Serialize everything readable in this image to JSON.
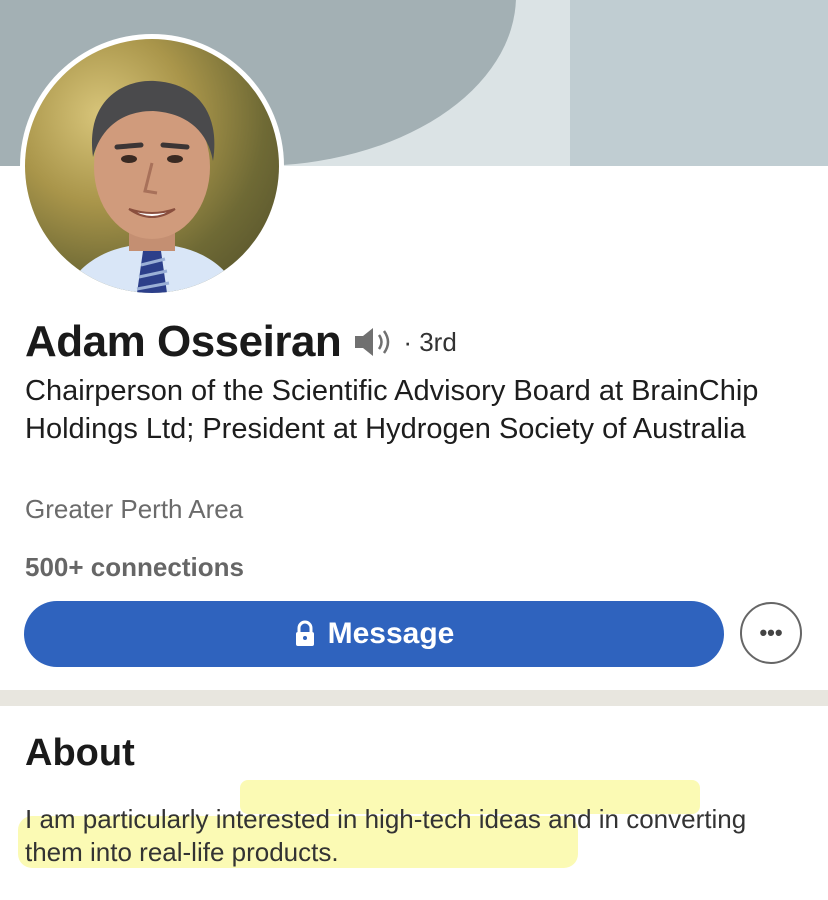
{
  "profile": {
    "name": "Adam Osseiran",
    "degree": "· 3rd",
    "headline": "Chairperson of the Scientific Advisory Board at BrainChip Holdings Ltd; President at Hydrogen Society of Australia",
    "location": "Greater Perth Area",
    "connections": "500+ connections"
  },
  "actions": {
    "message_label": "Message",
    "more_label": "•••"
  },
  "about": {
    "title": "About",
    "text": "I am particularly interested in high-tech ideas and in converting them into real-life products."
  },
  "icons": [
    "speaker-icon",
    "lock-icon",
    "more-icon"
  ],
  "colors": {
    "primary_button": "#2f63be",
    "highlight": "#fbfab0",
    "banner": "#a3b0b4"
  }
}
